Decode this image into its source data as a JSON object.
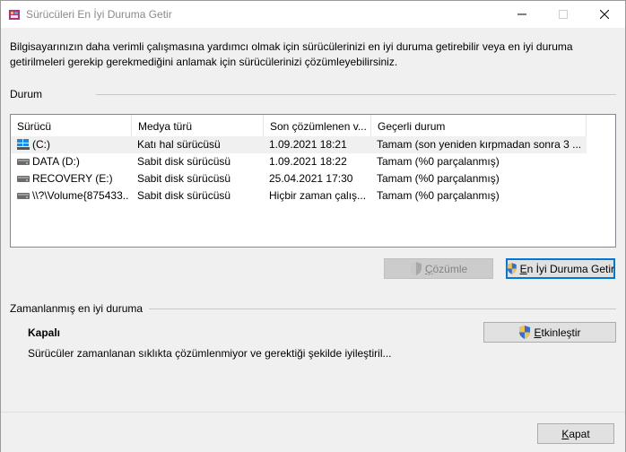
{
  "window": {
    "title": "Sürücüleri En İyi Duruma Getir",
    "icon": "defrag-app-icon"
  },
  "intro_text": "Bilgisayarınızın daha verimli çalışmasına yardımcı olmak için sürücülerinizi en iyi duruma getirebilir veya en iyi duruma getirilmeleri gerekip gerekmediğini anlamak için sürücülerinizi çözümleyebilirsiniz.",
  "status_section": {
    "label": "Durum",
    "columns": [
      "Sürücü",
      "Medya türü",
      "Son çözümlenen v...",
      "Geçerli durum"
    ],
    "rows": [
      {
        "drive": "(C:)",
        "media": "Katı hal sürücüsü",
        "last": "1.09.2021 18:21",
        "state": "Tamam (son yeniden kırpmadan sonra 3 ...",
        "icon": "windows-drive-icon",
        "selected": true
      },
      {
        "drive": "DATA (D:)",
        "media": "Sabit disk sürücüsü",
        "last": "1.09.2021 18:22",
        "state": "Tamam (%0 parçalanmış)",
        "icon": "hard-drive-icon",
        "selected": false
      },
      {
        "drive": "RECOVERY (E:)",
        "media": "Sabit disk sürücüsü",
        "last": "25.04.2021 17:30",
        "state": "Tamam (%0 parçalanmış)",
        "icon": "hard-drive-icon",
        "selected": false
      },
      {
        "drive": "\\\\?\\Volume{875433...",
        "media": "Sabit disk sürücüsü",
        "last": "Hiçbir zaman çalış...",
        "state": "Tamam (%0 parçalanmış)",
        "icon": "hard-drive-icon",
        "selected": false
      }
    ],
    "analyze_button": {
      "prefix": "",
      "hotkey": "Ç",
      "rest": "özümle",
      "enabled": false
    },
    "optimize_button": {
      "prefix": "",
      "hotkey": "E",
      "rest": "n İyi Duruma Getir",
      "enabled": true
    }
  },
  "scheduled_section": {
    "label": "Zamanlanmış en iyi duruma",
    "state": "Kapalı",
    "description": "Sürücüler zamanlanan sıklıkta çözümlenmiyor ve gerektiği şekilde iyileştiril...",
    "enable_button": {
      "hotkey": "E",
      "rest": "tkinleştir"
    }
  },
  "close_button": {
    "hotkey": "K",
    "rest": "apat"
  },
  "colors": {
    "selection": "#f0f0f0",
    "focus": "#0078d7",
    "window_bg": "#f0f0f0"
  }
}
